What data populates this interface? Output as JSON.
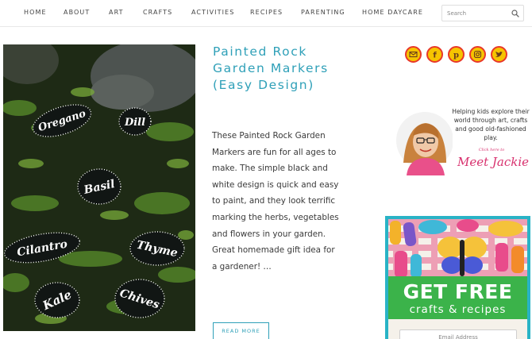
{
  "nav": {
    "items": [
      "HOME",
      "ABOUT",
      "ART",
      "CRAFTS",
      "ACTIVITIES",
      "RECIPES",
      "PARENTING",
      "HOME DAYCARE"
    ],
    "search_placeholder": "Search",
    "search_icon": "search-icon"
  },
  "article": {
    "image_labels": [
      "Oregano",
      "Dill",
      "Basil",
      "Cilantro",
      "Thyme",
      "Kale",
      "Chives"
    ],
    "title": "Painted Rock Garden Markers (Easy Design)",
    "excerpt": "These Painted Rock Garden Markers are fun for all ages to make. The simple black and white design is quick and easy to paint, and they look terrific marking the herbs, vegetables and flowers in your garden. Great homemade gift idea for a gardener! …",
    "read_more": "READ MORE"
  },
  "social": {
    "icons": [
      "email-icon",
      "facebook-icon",
      "pinterest-icon",
      "instagram-icon",
      "twitter-icon"
    ],
    "colors": {
      "fill": "#f6c400",
      "ring": "#e8372a"
    }
  },
  "meet": {
    "tagline": "Helping kids explore their world through art, crafts and good old-fashioned play.",
    "click": "Click here to",
    "name": "Meet Jackie"
  },
  "promo": {
    "headline": "GET FREE",
    "subline": "crafts & recipes",
    "email_placeholder": "Email Address"
  },
  "colors": {
    "accent": "#2fa0b8",
    "promo_green": "#3bb34a",
    "promo_frame": "#29b3c6",
    "script_pink": "#d8316e"
  }
}
